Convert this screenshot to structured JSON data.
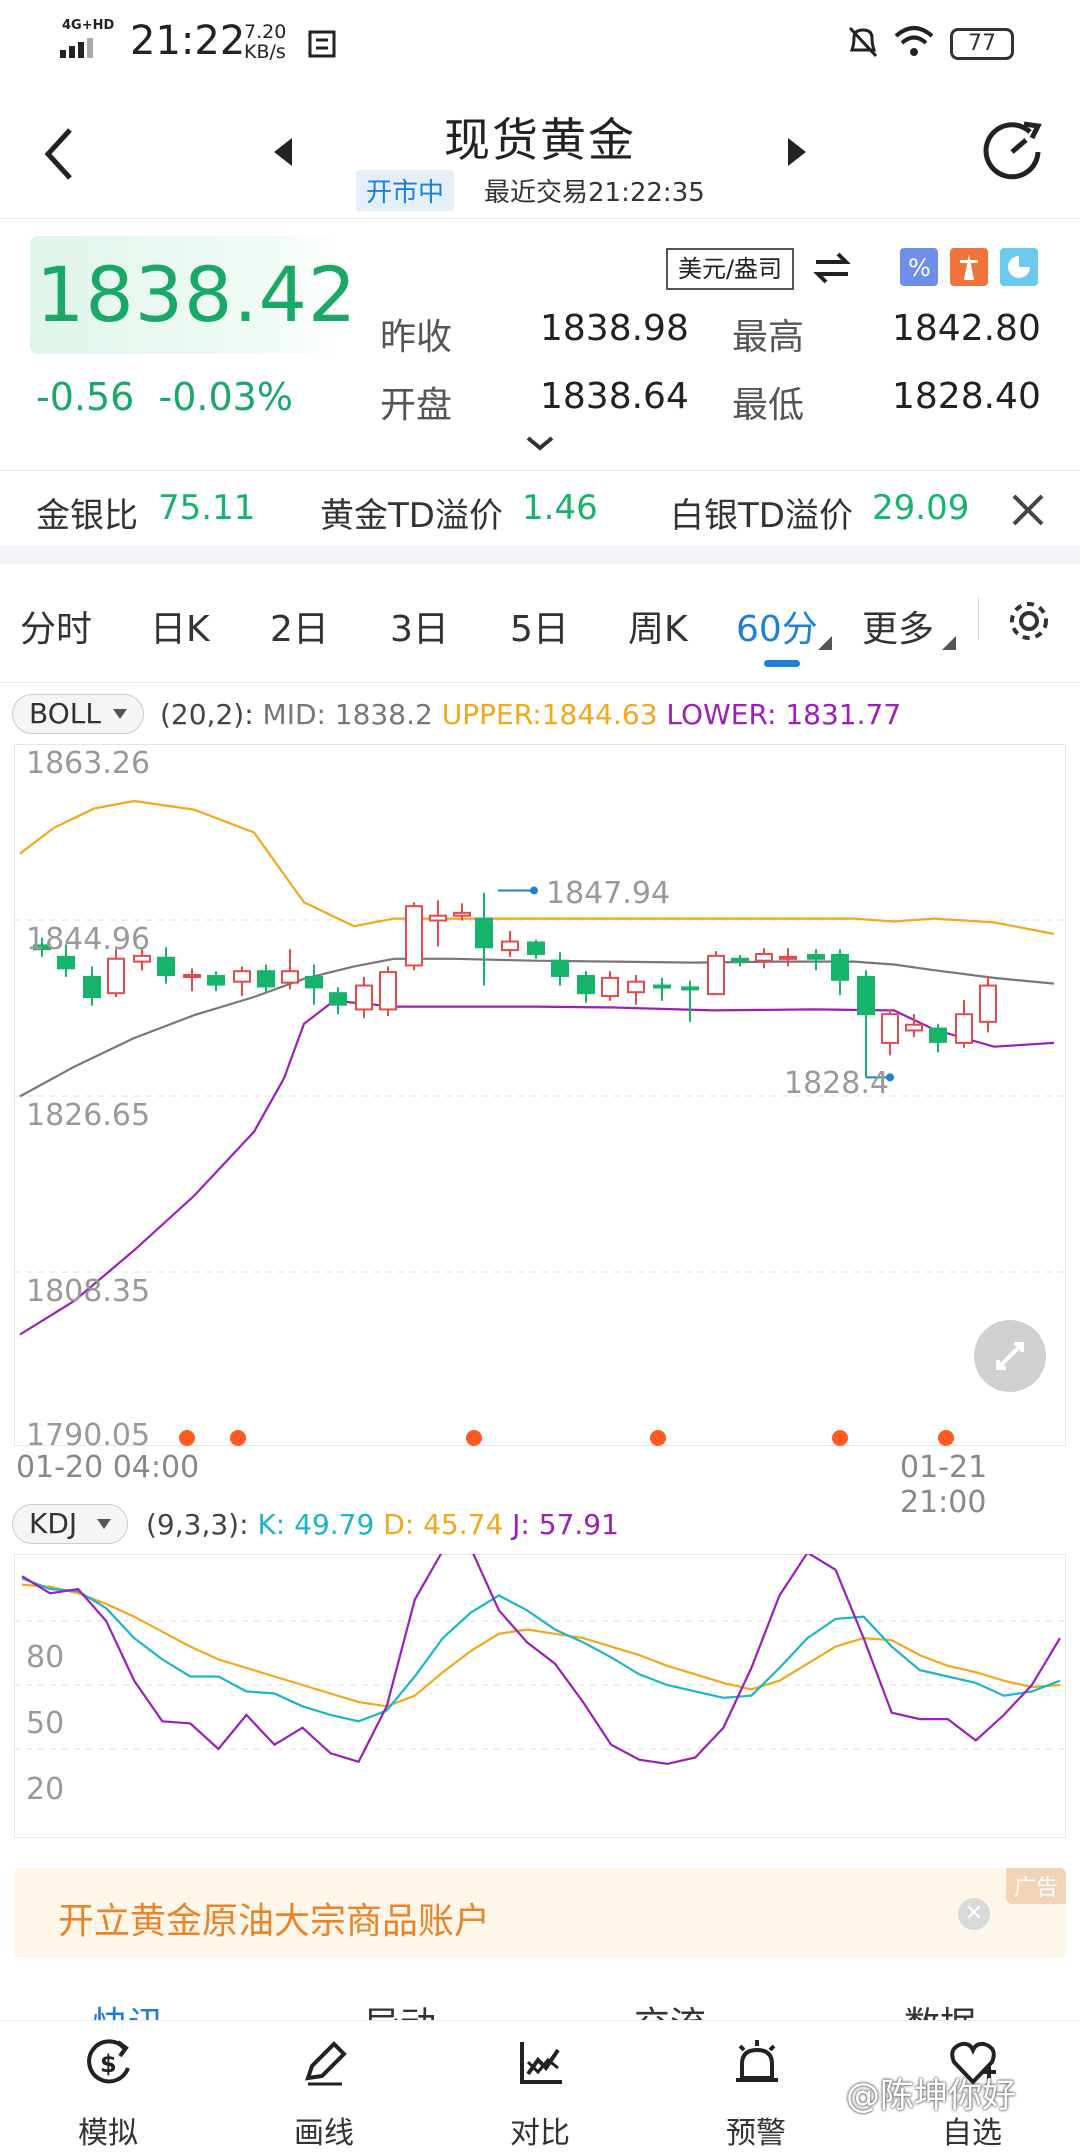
{
  "status_bar": {
    "network": "4G+HD",
    "time": "21:22",
    "speed_value": "7.20",
    "speed_unit": "KB/s",
    "battery": "77"
  },
  "header": {
    "title": "现货黄金",
    "status": "开市中",
    "last_trade": "最近交易21:22:35"
  },
  "quote": {
    "price": "1838.42",
    "change": "-0.56",
    "change_pct": "-0.03%",
    "unit": "美元/盎司",
    "prev_close_label": "昨收",
    "prev_close": "1838.98",
    "high_label": "最高",
    "high": "1842.80",
    "open_label": "开盘",
    "open": "1838.64",
    "low_label": "最低",
    "low": "1828.40"
  },
  "ratios": [
    {
      "label": "金银比",
      "value": "75.11"
    },
    {
      "label": "黄金TD溢价",
      "value": "1.46"
    },
    {
      "label": "白银TD溢价",
      "value": "29.09"
    }
  ],
  "period_tabs": [
    "分时",
    "日K",
    "2日",
    "3日",
    "5日",
    "周K",
    "60分",
    "更多"
  ],
  "active_tab": "60分",
  "boll": {
    "selector": "BOLL",
    "params": "(20,2):",
    "mid": "MID: 1838.2",
    "upper": "UPPER:1844.63",
    "lower": "LOWER: 1831.77",
    "y_labels": [
      "1863.26",
      "1844.96",
      "1826.65",
      "1808.35",
      "1790.05"
    ],
    "max_label": "1847.94",
    "min_label": "1828.4",
    "x_start": "01-20 04:00",
    "x_end": "01-21 21:00"
  },
  "kdj": {
    "selector": "KDJ",
    "params": "(9,3,3):",
    "k": "K: 49.79",
    "d": "D: 45.74",
    "j": "J: 57.91",
    "y_labels": [
      "80",
      "50",
      "20"
    ]
  },
  "colors": {
    "up": "#e5484d",
    "down": "#16b36b",
    "accent": "#1f7fd8",
    "upper": "#f0a81c",
    "mid": "#777777",
    "lower": "#9b1fb8",
    "k": "#1bb5c7",
    "d": "#f0a81c",
    "j": "#9b1fb8"
  },
  "ad": {
    "text": "开立黄金原油大宗商品账户",
    "tag": "广告"
  },
  "sub_tabs": [
    "快讯",
    "异动",
    "交流",
    "数据"
  ],
  "bottom_nav": [
    {
      "label": "模拟",
      "icon": "dollar-cycle-icon"
    },
    {
      "label": "画线",
      "icon": "pen-icon"
    },
    {
      "label": "对比",
      "icon": "chart-compare-icon"
    },
    {
      "label": "预警",
      "icon": "alarm-icon"
    },
    {
      "label": "自选",
      "icon": "heart-plus-icon"
    }
  ],
  "watermark": "@陈坤你好"
}
